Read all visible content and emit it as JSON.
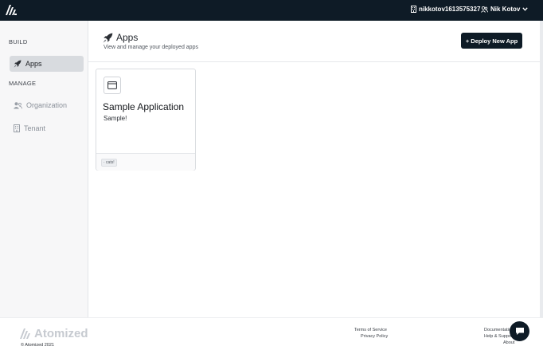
{
  "topbar": {
    "tenant": "nikkotov1613575327",
    "user": "Nik Kotov"
  },
  "sidebar": {
    "build_label": "BUILD",
    "manage_label": "MANAGE",
    "items": [
      {
        "label": "Apps",
        "icon": "rocket-icon",
        "active": true
      },
      {
        "label": "Organization",
        "icon": "users-icon",
        "active": false
      },
      {
        "label": "Tenant",
        "icon": "building-icon",
        "active": false
      }
    ]
  },
  "header": {
    "title": "Apps",
    "subtitle": "View and manage your deployed apps",
    "deploy_button": "+ Deploy New App"
  },
  "apps": [
    {
      "name": "Sample Application",
      "description": "Sample!",
      "tag": "· cats!"
    }
  ],
  "footer": {
    "brand": "Atomized",
    "copyright": "© Atomized 2021",
    "links_center": [
      "Terms of Service",
      "Privacy Policy"
    ],
    "links_right": [
      "Documentation",
      "Help & Support",
      "About"
    ]
  },
  "colors": {
    "topbar": "#0e1b26",
    "active_nav": "#d8dbdf",
    "button": "#0e1b26"
  }
}
